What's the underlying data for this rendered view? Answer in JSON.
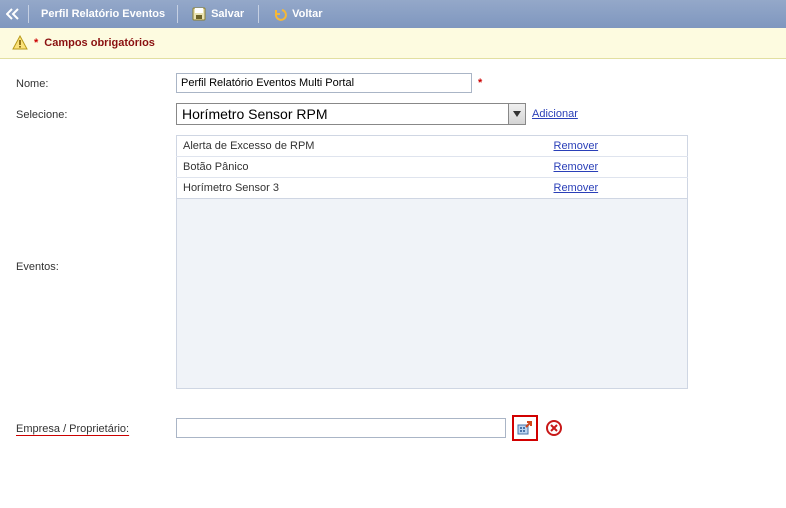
{
  "toolbar": {
    "title": "Perfil Relatório Eventos",
    "save_label": "Salvar",
    "back_label": "Voltar"
  },
  "notice": {
    "text": "Campos obrigatórios"
  },
  "form": {
    "nome_label": "Nome:",
    "nome_value": "Perfil Relatório Eventos Multi Portal",
    "selecione_label": "Selecione:",
    "selecione_value": "Horímetro Sensor RPM",
    "adicionar_label": "Adicionar",
    "eventos_label": "Eventos:",
    "remover_label": "Remover",
    "eventos": [
      {
        "name": "Alerta de Excesso de RPM"
      },
      {
        "name": "Botão Pânico"
      },
      {
        "name": "Horímetro Sensor 3"
      }
    ],
    "empresa_label": "Empresa / Proprietário:",
    "empresa_value": ""
  }
}
